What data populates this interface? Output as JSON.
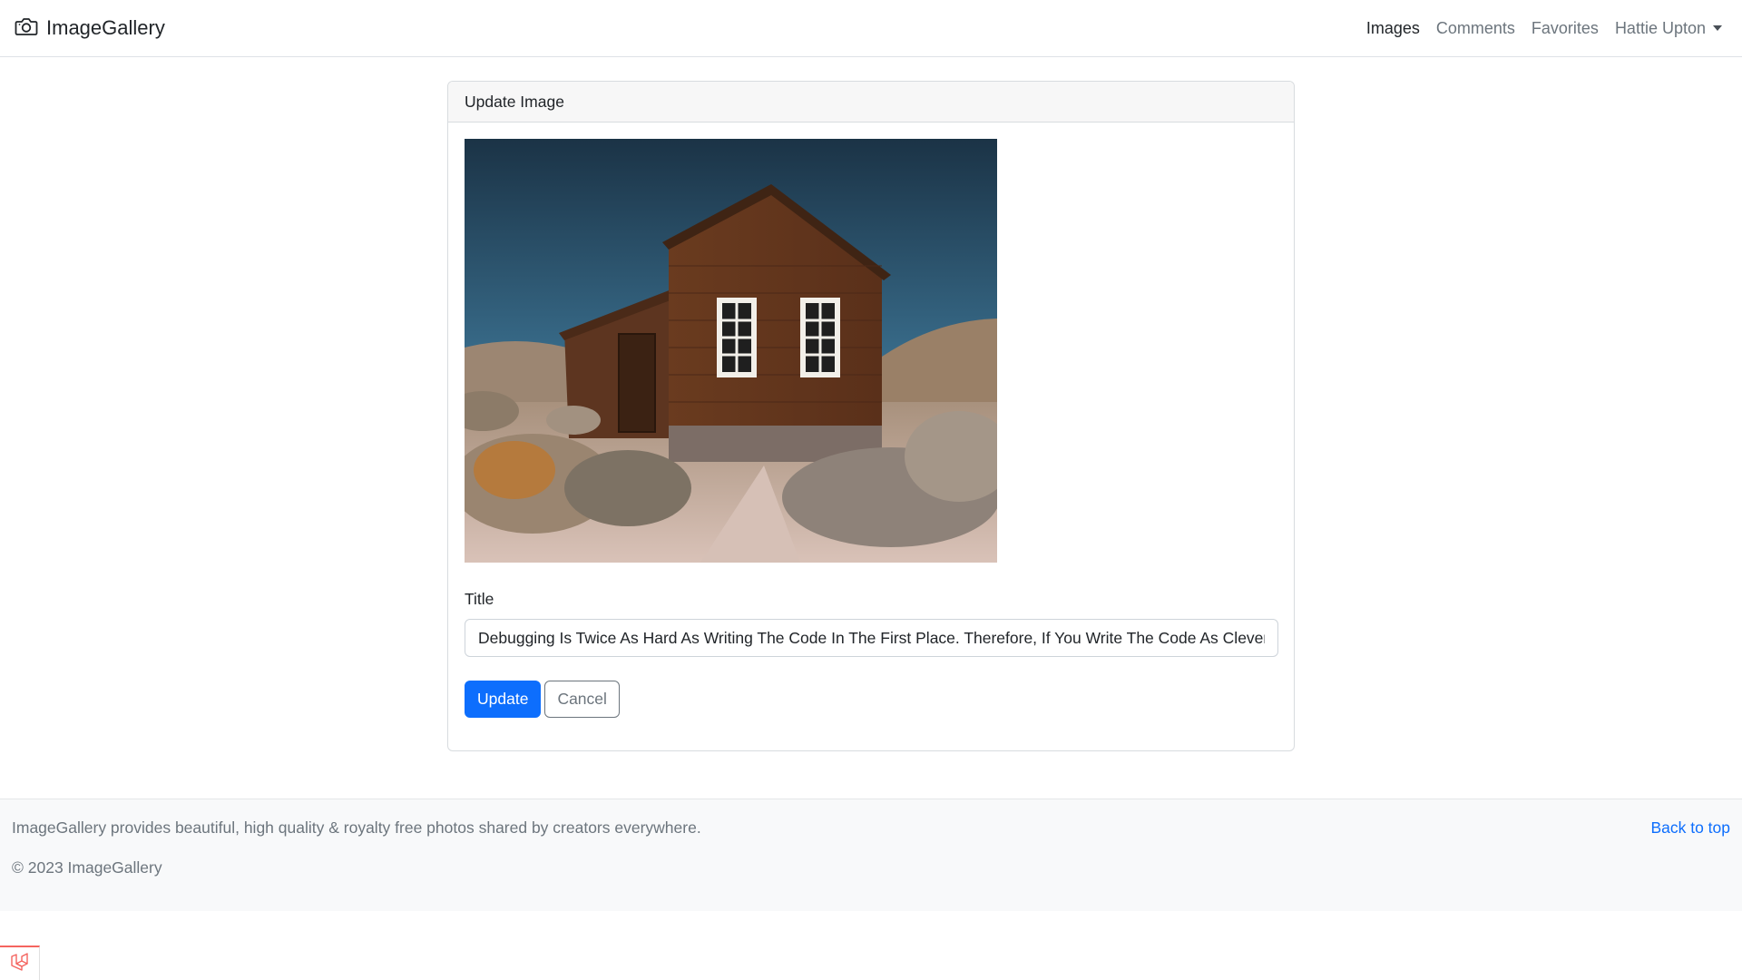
{
  "navbar": {
    "brand": "ImageGallery",
    "links": {
      "images": "Images",
      "comments": "Comments",
      "favorites": "Favorites"
    },
    "user": "Hattie Upton"
  },
  "card": {
    "header": "Update Image",
    "title_label": "Title",
    "title_value": "Debugging Is Twice As Hard As Writing The Code In The First Place. Therefore, If You Write The Code As Cleverly",
    "update_label": "Update",
    "cancel_label": "Cancel"
  },
  "footer": {
    "description": "ImageGallery provides beautiful, high quality & royalty free photos shared by creators everywhere.",
    "copyright": "© 2023 ImageGallery",
    "back_to_top": "Back to top"
  },
  "colors": {
    "primary": "#0d6efd",
    "muted": "#6c757d",
    "debugbar_accent": "#f4645f"
  }
}
